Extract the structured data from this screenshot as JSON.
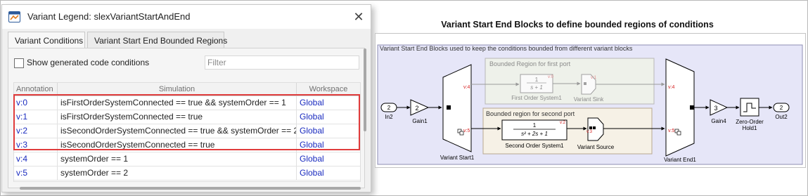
{
  "window": {
    "title": "Variant Legend: slexVariantStartAndEnd",
    "close_glyph": "✕",
    "app_icon": "simulink-icon"
  },
  "tabs": [
    {
      "label": "Variant Conditions",
      "active": true
    },
    {
      "label": "Variant Start End Bounded Regions",
      "active": false
    }
  ],
  "options": {
    "show_generated_label": "Show generated code conditions",
    "show_generated_checked": false,
    "filter_placeholder": "Filter",
    "filter_value": ""
  },
  "table": {
    "headers": {
      "annotation": "Annotation",
      "simulation": "Simulation",
      "workspace": "Workspace"
    },
    "rows": [
      {
        "annotation": "v:0",
        "simulation": "isFirstOrderSystemConnected == true && systemOrder == 1",
        "workspace": "Global",
        "highlighted": true
      },
      {
        "annotation": "v:1",
        "simulation": "isFirstOrderSystemConnected == true",
        "workspace": "Global",
        "highlighted": true
      },
      {
        "annotation": "v:2",
        "simulation": "isSecondOrderSystemConnected == true && systemOrder == 2",
        "workspace": "Global",
        "highlighted": true
      },
      {
        "annotation": "v:3",
        "simulation": "isSecondOrderSystemConnected == true",
        "workspace": "Global",
        "highlighted": true
      },
      {
        "annotation": "v:4",
        "simulation": "systemOrder == 1",
        "workspace": "Global",
        "highlighted": false
      },
      {
        "annotation": "v:5",
        "simulation": "systemOrder == 2",
        "workspace": "Global",
        "highlighted": false
      }
    ]
  },
  "model": {
    "title": "Variant Start End Blocks to define bounded regions of conditions",
    "area_label": "Variant Start End Blocks used to keep the conditions bounded from different variant blocks",
    "region1_label": "Bounded Region for first port",
    "region2_label": "Bounded region for second port",
    "blocks": {
      "in2": {
        "port": "2",
        "name": "In2"
      },
      "gain1": {
        "value": "2",
        "name": "Gain1"
      },
      "variant_start": {
        "name": "Variant Start1",
        "tags": [
          "v:4",
          "v:5"
        ]
      },
      "first_order": {
        "num": "1",
        "den": "s + 1",
        "name": "First Order System1",
        "tag": "v:0"
      },
      "variant_sink": {
        "name": "Variant Sink",
        "tag": "v:1"
      },
      "second_order": {
        "num": "1",
        "den": "s² + 2s + 1",
        "name": "Second Order System1",
        "tag": "v:2"
      },
      "variant_source": {
        "name": "Variant Source",
        "tag": "v:3"
      },
      "variant_end": {
        "name": "Variant End1",
        "tags": [
          "v:4",
          "v:5"
        ]
      },
      "gain4": {
        "value": "3",
        "name": "Gain4"
      },
      "zoh": {
        "name_line1": "Zero-Order",
        "name_line2": "Hold1"
      },
      "out2": {
        "port": "2",
        "name": "Out2"
      }
    }
  },
  "colors": {
    "highlight": "#e03c3c",
    "link_blue": "#1a2bbf",
    "annotation_red": "#d42020",
    "area_fill": "#e6e6f8",
    "region1_fill": "#eef1ea",
    "region2_fill": "#f6f1e6"
  }
}
